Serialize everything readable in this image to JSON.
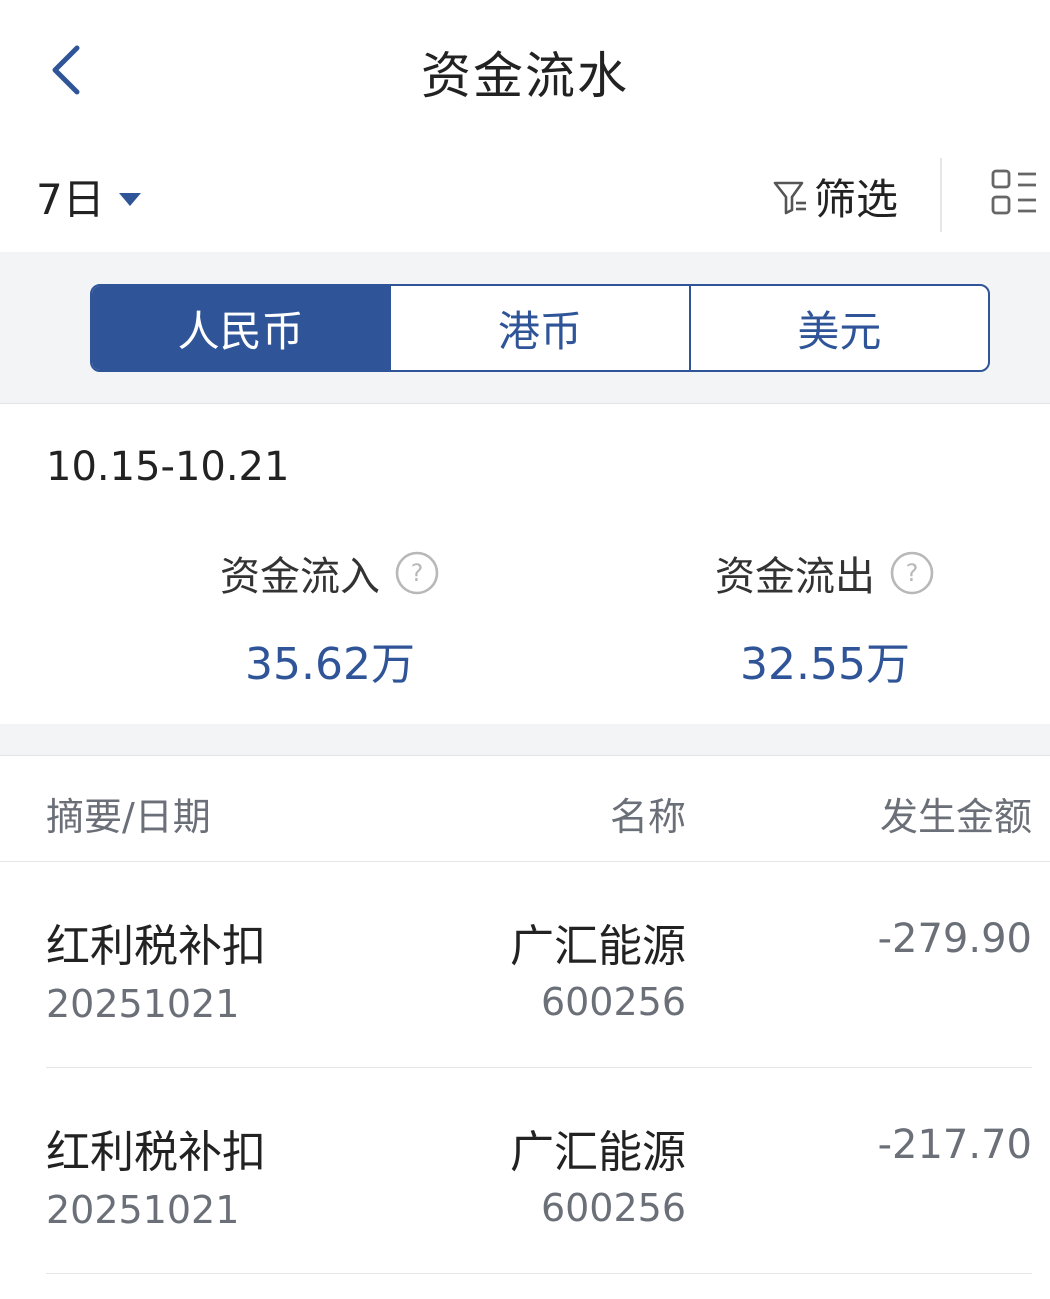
{
  "header": {
    "title": "资金流水",
    "back_icon": "chevron-left-icon"
  },
  "toolbar": {
    "period": "7日",
    "filter_label": "筛选",
    "filter_icon": "filter-icon",
    "layout_icon": "list-layout-icon"
  },
  "currency_tabs": [
    {
      "label": "人民币",
      "active": true
    },
    {
      "label": "港币",
      "active": false
    },
    {
      "label": "美元",
      "active": false
    }
  ],
  "summary": {
    "date_range": "10.15-10.21",
    "inflow": {
      "label": "资金流入",
      "value": "35.62万"
    },
    "outflow": {
      "label": "资金流出",
      "value": "32.55万"
    }
  },
  "table": {
    "headers": {
      "summary_date": "摘要/日期",
      "name": "名称",
      "amount": "发生金额"
    },
    "rows": [
      {
        "summary": "红利税补扣",
        "date": "20251021",
        "name": "广汇能源",
        "code": "600256",
        "amount": "-279.90"
      },
      {
        "summary": "红利税补扣",
        "date": "20251021",
        "name": "广汇能源",
        "code": "600256",
        "amount": "-217.70"
      }
    ]
  },
  "colors": {
    "accent": "#2f5598",
    "muted_text": "#6b6f78",
    "band": "#f3f4f6"
  }
}
